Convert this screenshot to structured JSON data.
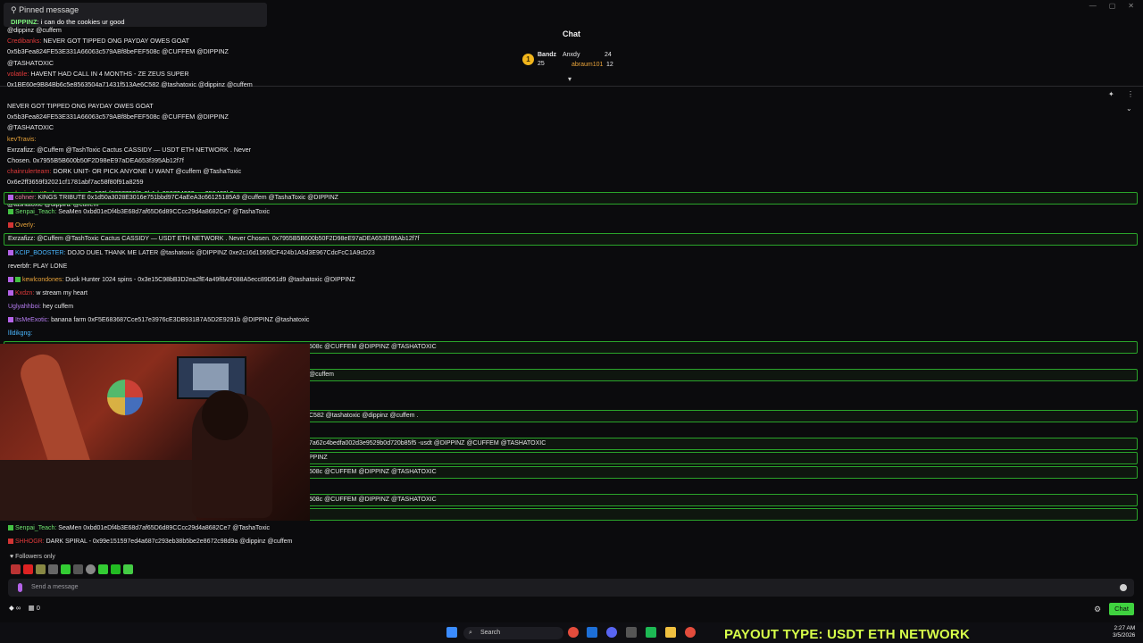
{
  "pinned": {
    "title": "Pinned message",
    "user": "DIPPINZ",
    "text": "i can do the cookies ur good"
  },
  "chat_header": "Chat",
  "leaderboard": {
    "first": {
      "name": "Bandz",
      "count": "25"
    },
    "second": {
      "name": "Anxdy",
      "count": "24"
    },
    "third": {
      "name": "abraum101",
      "count": "12"
    }
  },
  "top_messages": [
    {
      "user": "@dippinz @cuffem",
      "text": "",
      "color": "u-wht"
    },
    {
      "user": "Credibanks:",
      "text": "NEVER GOT TIPPED ONG PAYDAY OWES GOAT",
      "color": "u-red"
    },
    {
      "user": "",
      "text": "0x5b3Fea824FE53E331A66063c579ABf8beFEF508c @CUFFEM @DIPPINZ",
      "color": "u-wht"
    },
    {
      "user": "",
      "text": "@TASHATOXIC",
      "color": "u-wht"
    },
    {
      "user": "volatile:",
      "text": "HAVENT HAD CALL IN 4 MONTHS - ZE ZEUS SUPER",
      "color": "u-red"
    },
    {
      "user": "",
      "text": "0x1BE60e9B84Bb6c5e8563504a71431f513Ae6C582 @tashatoxic @dippinz @cuffem",
      "color": "u-wht"
    }
  ],
  "overlay_messages": [
    {
      "user": "",
      "text": "NEVER GOT TIPPED ONG PAYDAY OWES GOAT"
    },
    {
      "user": "",
      "text": "0x5b3Fea824FE53E331A66063c579ABf8beFEF508c @CUFFEM @DIPPINZ"
    },
    {
      "user": "",
      "text": "@TASHATOXIC"
    },
    {
      "user": "kevTravis:",
      "text": ""
    },
    {
      "user": "Exrzafizz:",
      "text": "@Cuffem @TashToxic   Cactus CASSIDY — USDT ETH NETWORK . Never"
    },
    {
      "user": "",
      "text": "Chosen.   0x7955B5B600b50F2D98eE97aDEA653f395Ab12f7f"
    },
    {
      "user": "chainrulerteam:",
      "text": "DORK UNIT- OR PICK ANYONE U WANT @cuffem @TashaToxic"
    },
    {
      "user": "",
      "text": "0x6e2ff3659f32021cf1781abf7ac58f80f91a8259"
    },
    {
      "user": "webmindsett2:",
      "text": "dragon spire 0x622bf8727720f7a5b1da959704933aae350470b5"
    },
    {
      "user": "",
      "text": "@tashatoxic @dippinz @cuffem"
    }
  ],
  "messages": [
    {
      "user": "cohner:",
      "text": "KINGS TRIBUTE 0x1d50a3028E3016e751bbd97C4aEeA3c66125185A9 @cuffem @TashaToxic @DIPPINZ",
      "color": "u-pnk",
      "band": true
    },
    {
      "user": "Senpai_Teach:",
      "text": "SeaMen   0xbd01eDf4b3E68d7af65D6d89CCcc29d4a8682Ce7 @TashaToxic",
      "color": "u-grn",
      "band": false
    },
    {
      "user": "Overly:",
      "text": "",
      "color": "u-org",
      "band": false
    },
    {
      "user": "Exrzafizz:",
      "text": "@Cuffem @TashToxic      Cactus CASSIDY — USDT ETH NETWORK . Never Chosen.      0x7955B5B600b50F2D98eE97aDEA653f395Ab12f7f",
      "color": "u-wht",
      "band": true
    },
    {
      "user": "KCIP_BOOSTER:",
      "text": "DOJO DUEL THANK ME LATER @tashatoxic @DIPPINZ        0xe2c16d1565fCF424b1A5d3E967CdcFcC1A9cD23",
      "color": "u-blu",
      "band": false
    },
    {
      "user": "reverbfr:",
      "text": "PLAY LONE",
      "color": "u-wht",
      "band": false
    },
    {
      "user": "kewlcondones:",
      "text": "Duck Hunter 1024 spins - 0x3e15C98bB3D2ea2fE4a49fBAF088A5ecc89D61d9        @tashatoxic @DIPPINZ",
      "color": "u-org",
      "band": false
    },
    {
      "user": "Kxdzn:",
      "text": "w stream my heart",
      "color": "u-red",
      "band": false
    },
    {
      "user": "Uglyahhboi:",
      "text": "hey cuffem",
      "color": "u-pur",
      "band": false
    },
    {
      "user": "ItsMeExotic:",
      "text": "banana farm 0xF5E683687Cce517e3976cE3DB931B7A5D2E9291b @DIPPINZ @tashatoxic",
      "color": "u-pur",
      "band": false
    },
    {
      "user": "llldikgng:",
      "text": "",
      "color": "u-blu",
      "band": false
    }
  ],
  "right_fragments": [
    "508c @CUFFEM @DIPPINZ @TASHATOXIC",
    "@cuffem",
    "C582 @tashatoxic @dippinz @cuffem .",
    "7a62c4bedfa002d3e9529b0d720b85f5 -usdt @DIPPINZ @CUFFEM @TASHATOXIC",
    "PPINZ",
    "508c @CUFFEM @DIPPINZ @TASHATOXIC",
    "508c @CUFFEM @DIPPINZ @TASHATOXIC"
  ],
  "bottom_messages": [
    {
      "user": "Senpai_Teach:",
      "text": "SeaMen   0xbd01eDf4b3E68d7af65D6d89CCcc29d4a8682Ce7 @TashaToxic",
      "color": "u-grn"
    },
    {
      "user": "SHHOGR:",
      "text": "DARK SPIRAL - 0x99e151597ed4a687c293eb38b5be2e8672c98d9a @dippinz @cuffem",
      "color": "u-red"
    }
  ],
  "followers_only": "Followers only",
  "input_placeholder": "Send a message",
  "bottom_bar": {
    "points": "0",
    "infinity": "∞"
  },
  "chat_button": "Chat",
  "taskbar": {
    "search": "Search",
    "payout": "PAYOUT TYPE: USDT ETH NETWORK",
    "time": "2:27 AM",
    "date": "3/5/2026"
  },
  "colors": {
    "accent": "#3fd23f",
    "payout": "#d7ff4a",
    "band_border": "#2aa52a"
  }
}
